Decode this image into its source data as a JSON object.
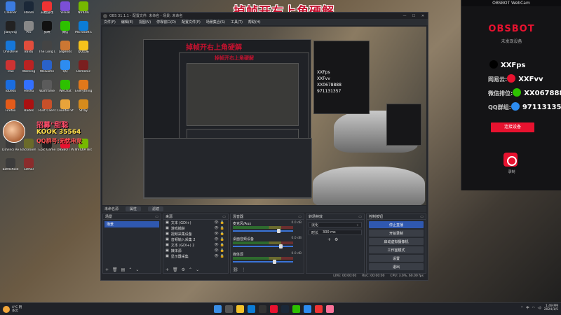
{
  "headline": "掉帧开右上角硬解",
  "desktop_icons": [
    {
      "label": "Cleaner",
      "color": "#3b7be0"
    },
    {
      "label": "Steam",
      "color": "#1b2838"
    },
    {
      "label": "开始游戏",
      "color": "#e33"
    },
    {
      "label": "Visual",
      "color": "#7b4fd6"
    },
    {
      "label": "NVIDIA",
      "color": "#76b900"
    },
    {
      "label": "Jianying",
      "color": "#222"
    },
    {
      "label": "Pro",
      "color": "#888"
    },
    {
      "label": "剪映",
      "color": "#111"
    },
    {
      "label": "微信",
      "color": "#2dc100"
    },
    {
      "label": "Microsoft Edge",
      "color": "#0c7cd5"
    },
    {
      "label": "OneDrive",
      "color": "#1677d9"
    },
    {
      "label": "Baidu",
      "color": "#e14d3c"
    },
    {
      "label": "The Long Dark",
      "color": "#444"
    },
    {
      "label": "Legends",
      "color": "#c73"
    },
    {
      "label": "QQ音乐",
      "color": "#f5c21b"
    },
    {
      "label": "Trae",
      "color": "#c33"
    },
    {
      "label": "Warning",
      "color": "#b22"
    },
    {
      "label": "WeGame",
      "color": "#2a62c9"
    },
    {
      "label": "QQ",
      "color": "#2d8cf0"
    },
    {
      "label": "Demonic",
      "color": "#7a1f1f"
    },
    {
      "label": "ToDesk",
      "color": "#1a6de0"
    },
    {
      "label": "Feishu",
      "color": "#3370ff"
    },
    {
      "label": "Warframe",
      "color": "#5b5b5b"
    },
    {
      "label": "WeChat",
      "color": "#2dc100"
    },
    {
      "label": "Everything",
      "color": "#e2781a"
    },
    {
      "label": "Firefox",
      "color": "#e55b1a"
    },
    {
      "label": "Hades",
      "color": "#a11"
    },
    {
      "label": "Rust Client",
      "color": "#c8502a"
    },
    {
      "label": "Counter-Strike 2",
      "color": "#e8a33a"
    },
    {
      "label": "Stray",
      "color": "#d68b1c"
    },
    {
      "label": "DaVinci Resolve",
      "color": "#3b3b3b"
    },
    {
      "label": "Backroom Company",
      "color": "#6a6a2a"
    },
    {
      "label": "Epic Games",
      "color": "#222"
    },
    {
      "label": "OBSBOT WebCam",
      "color": "#e8122f"
    },
    {
      "label": "NVIDIA Broadcast",
      "color": "#76b900"
    },
    {
      "label": "Battlefield",
      "color": "#3c3c3c"
    },
    {
      "label": "Lethal",
      "color": "#8a2c2c"
    }
  ],
  "promo": {
    "line1": "招募\"甜聪",
    "line2": "KOOK 35564",
    "line3": "QQ群号:无忧电竞"
  },
  "obs": {
    "title": "OBS 31.1.1 - 配置文件: 未命名 - 场景: 未命名",
    "menu": [
      "文件(F)",
      "编辑(E)",
      "视图(V)",
      "停靠窗口(D)",
      "配置文件(P)",
      "场景集合(S)",
      "工具(T)",
      "帮助(H)"
    ],
    "preview_title": "掉帧开右上角硬解",
    "scene_bar": {
      "label": "未命名源",
      "props": "属性",
      "filters": "滤镜"
    },
    "docks": {
      "scenes": {
        "title": "场景",
        "items": [
          "场景"
        ]
      },
      "sources": {
        "title": "来源",
        "items": [
          "文本 (GDI+)",
          "游戏捕获",
          "视频采集设备",
          "音频输入采集 2",
          "文本 (GDI+) 2",
          "媒体源",
          "显示器采集"
        ]
      },
      "mixer": {
        "title": "混音器",
        "channels": [
          {
            "name": "麦克风/Aux",
            "db": "0.0 dB",
            "level": 0.78
          },
          {
            "name": "桌面音频设备",
            "db": "0.0 dB",
            "level": 0.82
          },
          {
            "name": "媒体源",
            "db": "0.0 dB",
            "level": 0.7
          }
        ]
      },
      "transitions": {
        "title": "转场特效",
        "type": "淡化",
        "duration_label": "时长",
        "duration": "300 ms"
      },
      "controls": {
        "title": "控制按钮",
        "buttons": [
          "停止直播",
          "开始录制",
          "启动虚拟摄像机",
          "工作室模式",
          "设置",
          "退出"
        ]
      }
    },
    "status": {
      "live": "LIVE: 00:00:00",
      "rec": "REC: 00:00:00",
      "cpu": "CPU: 3.0%, 60.00 fps"
    }
  },
  "webcam": {
    "window_title": "OBSBOT WebCam",
    "logo": "OBSBOT",
    "subtitle": "未发现设备",
    "lines": [
      {
        "text": "XXFps",
        "icon_color": "#000"
      },
      {
        "text": "XXFvv",
        "icon_color": "#e8122f"
      },
      {
        "text": "XX0678888",
        "icon_color": "#2dc100"
      },
      {
        "text": "971131357",
        "icon_color": "#2d8cf0"
      }
    ],
    "line_prefixes": [
      "",
      "网易云:",
      "微信排位:",
      "QQ群组:"
    ],
    "button": "连接设备",
    "record_label": "录制"
  },
  "taskbar": {
    "weather_temp": "4°C 阴",
    "weather_desc": "多云",
    "clock_time": "1:49 PM",
    "clock_date": "2024/1/5",
    "tray": [
      "^",
      "中",
      "Wi-Fi",
      "音量"
    ],
    "apps": [
      {
        "name": "windows-start",
        "color": "#3a8ee6"
      },
      {
        "name": "search",
        "color": "#555"
      },
      {
        "name": "file-explorer",
        "color": "#f3c22a"
      },
      {
        "name": "edge",
        "color": "#0c7cd5"
      },
      {
        "name": "obs",
        "color": "#333"
      },
      {
        "name": "obsbot",
        "color": "#e8122f"
      },
      {
        "name": "steam",
        "color": "#1b2838"
      },
      {
        "name": "wechat",
        "color": "#2dc100"
      },
      {
        "name": "qq",
        "color": "#2d8cf0"
      },
      {
        "name": "netease",
        "color": "#e33"
      },
      {
        "name": "bilibili",
        "color": "#fb7299"
      }
    ]
  }
}
